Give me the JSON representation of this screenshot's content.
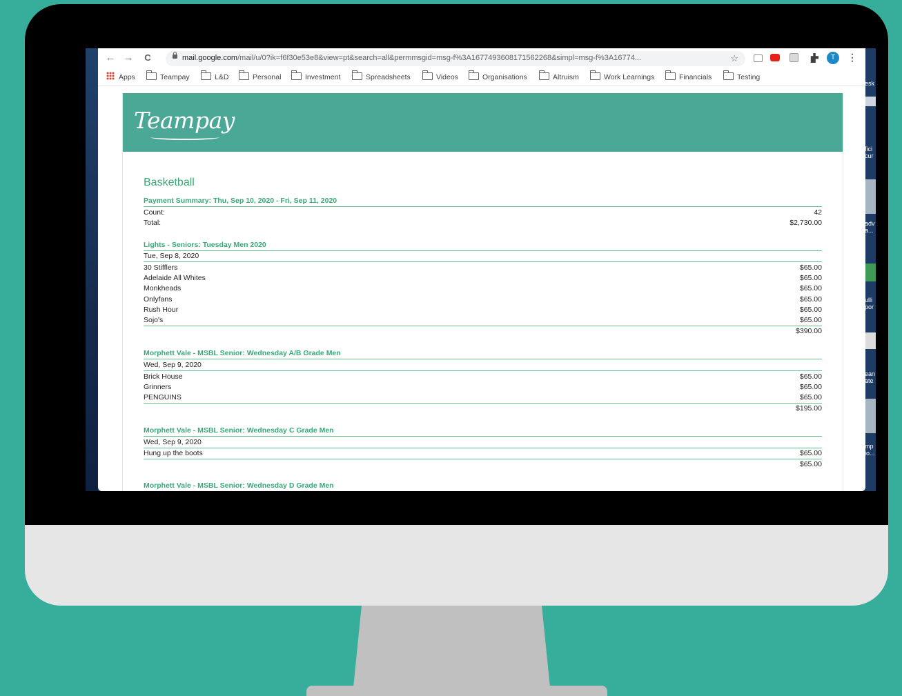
{
  "browser": {
    "url_host": "mail.google.com",
    "url_rest": "/mail/u/0?ik=f6f30e53e8&view=pt&search=all&permmsgid=msg-f%3A1677493608171562268&simpl=msg-f%3A16774...",
    "profile_initial": "T",
    "nav_back": "←",
    "nav_forward": "→",
    "nav_reload": "C",
    "star": "☆",
    "menu": "⋮",
    "extension_icons": [
      "mail-icon",
      "youtube-icon",
      "extension-icon",
      "puzzle-icon"
    ],
    "colors": {
      "youtube": "#e62117",
      "avatar": "#1e88c7"
    }
  },
  "bookmarks": [
    "Apps",
    "Teampay",
    "L&D",
    "Personal",
    "Investment",
    "Spreadsheets",
    "Videos",
    "Organisations",
    "Altruism",
    "Work Learnings",
    "Financials",
    "Testing"
  ],
  "email": {
    "logo": "Teampay",
    "sport": "Basketball",
    "summary": {
      "title": "Payment Summary: Thu, Sep 10, 2020 - Fri, Sep 11, 2020",
      "count_label": "Count:",
      "count_value": "42",
      "total_label": "Total:",
      "total_value": "$2,730.00"
    },
    "sections": [
      {
        "title": "Lights - Seniors: Tuesday Men 2020",
        "date": "Tue, Sep 8, 2020",
        "items": [
          {
            "team": "30 Stifflers",
            "amount": "$65.00"
          },
          {
            "team": "Adelaide All Whites",
            "amount": "$65.00"
          },
          {
            "team": "Monkheads",
            "amount": "$65.00"
          },
          {
            "team": "Onlyfans",
            "amount": "$65.00"
          },
          {
            "team": "Rush Hour",
            "amount": "$65.00"
          },
          {
            "team": "Sojo's",
            "amount": "$65.00"
          }
        ],
        "subtotal": "$390.00"
      },
      {
        "title": "Morphett Vale - MSBL Senior: Wednesday A/B Grade Men",
        "date": "Wed, Sep 9, 2020",
        "items": [
          {
            "team": "Brick House",
            "amount": "$65.00"
          },
          {
            "team": "Grinners",
            "amount": "$65.00"
          },
          {
            "team": "PENGUINS",
            "amount": "$65.00"
          }
        ],
        "subtotal": "$195.00"
      },
      {
        "title": "Morphett Vale - MSBL Senior: Wednesday C Grade Men",
        "date": "Wed, Sep 9, 2020",
        "items": [
          {
            "team": "Hung up the boots",
            "amount": "$65.00"
          }
        ],
        "subtotal": "$65.00"
      },
      {
        "title": "Morphett Vale - MSBL Senior: Wednesday D Grade Men"
      }
    ],
    "accent_color": "#3aa876",
    "header_color": "#4ca896"
  },
  "desktop_fragments": [
    "esk",
    "fici\ncur",
    "adv\na...",
    "ulli\npor",
    "ean\nate",
    "mp\nio..."
  ]
}
